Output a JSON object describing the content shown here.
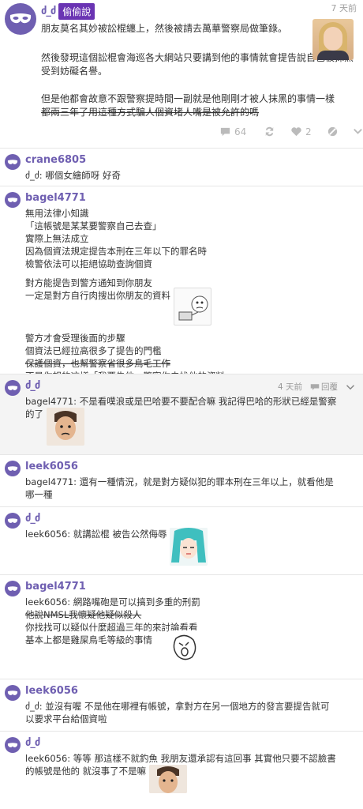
{
  "op": {
    "author_symbol": "ძ_ძ",
    "badge": "偷偷說",
    "date": "7 天前",
    "paragraphs": [
      "朋友莫名其妙被訟棍纏上，然後被請去萬華警察局做筆錄。",
      "然後發現這個訟棍會海巡各大網站只要講到他的事情就會提告說自己被抹黑受到妨礙名譽。"
    ],
    "para3": "但是他都會故意不跟警察提時間一副就是他剛剛才被人抹黑的事情一樣",
    "para3_strike": "都兩三年了用這種方式騙人個資堵人嘴是被允許的嗎",
    "comment_count": "64",
    "like_count": "2"
  },
  "replies": [
    {
      "name": "crane6805",
      "lines": [
        "ძ_ძ: 哪個女繪師呀 好奇"
      ]
    },
    {
      "name": "bagel4771",
      "block1": [
        "無用法律小知識",
        "「這帳號是某某要警察自己去查」",
        "實際上無法成立",
        "因為個資法規定提告本刑在三年以下的罪名時",
        "檢警依法可以拒絕協助查詢個資"
      ],
      "block2": [
        "對方能提告到警方通知到你朋友",
        "一定是對方自行肉搜出你朋友的資料"
      ],
      "block3a": [
        "警方才會受理後面的步驟",
        "個資法已經拉高很多了提告的門檻"
      ],
      "block3_strike": "保護個資，也幫警察省很多鳥毛工作",
      "block3b": "不是你想的這樣「我要告他，警察你去找他的資料」"
    },
    {
      "name": "ძ_ძ",
      "date": "4 天前",
      "reply_label": "回覆",
      "line1": "bagel4771: 不是看噗浪或是巴哈要不要配合嘛 我記得巴哈的形狀已經是警察",
      "line2": "的了"
    },
    {
      "name": "leek6056",
      "line1": "bagel4771: 還有一種情況，就是對方疑似犯的罪本刑在三年以上，就看他是",
      "line2": "哪一種"
    },
    {
      "name": "ძ_ძ",
      "line1": "leek6056: 就講訟棍 被告公然侮辱"
    },
    {
      "name": "bagel4771",
      "line1": "leek6056: 網路嘴砲是可以搞到多重的刑罰",
      "line2_strike": "他說NMSL我懷疑他疑似殺人",
      "line3": "你找找可以疑似什麼超過三年的來討論看看",
      "line4": "基本上都是雞屎鳥毛等級的事情"
    },
    {
      "name": "leek6056",
      "line1": "ძ_ძ: 並沒有喔 不是他在哪裡有帳號，拿對方在另一個地方的發言要提告就可",
      "line2": "以要求平台給個資啦"
    },
    {
      "name": "ძ_ძ",
      "line1": "leek6056: 等等 那這樣不就釣魚 我朋友還承認有這回事 其實他只要不認臉書",
      "line2": "的帳號是他的 就沒事了不是嘛"
    }
  ],
  "colors": {
    "accent": "#6f5fb1",
    "badge": "#6a34b3",
    "muted": "#a0a0a0"
  }
}
